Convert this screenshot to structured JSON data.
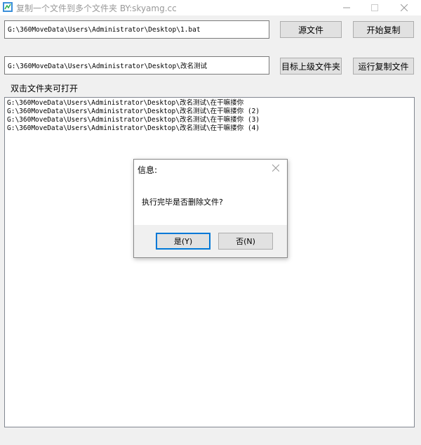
{
  "window": {
    "title": "复制一个文件到多个文件夹  BY:skyamg.cc"
  },
  "source": {
    "path": "G:\\360MoveData\\Users\\Administrator\\Desktop\\1.bat",
    "button_label": "源文件",
    "start_button_label": "开始复制"
  },
  "target": {
    "path": "G:\\360MoveData\\Users\\Administrator\\Desktop\\改名测试",
    "parent_button_label": "目标上级文件夹",
    "run_button_label": "运行复制文件"
  },
  "list": {
    "label": "双击文件夹可打开",
    "items": [
      "G:\\360MoveData\\Users\\Administrator\\Desktop\\改名测试\\在干嘛搂你",
      "G:\\360MoveData\\Users\\Administrator\\Desktop\\改名测试\\在干嘛搂你 (2)",
      "G:\\360MoveData\\Users\\Administrator\\Desktop\\改名测试\\在干嘛搂你 (3)",
      "G:\\360MoveData\\Users\\Administrator\\Desktop\\改名测试\\在干嘛搂你 (4)"
    ]
  },
  "dialog": {
    "title": "信息:",
    "message": "执行完毕是否删除文件?",
    "yes_label": "是(Y)",
    "no_label": "否(N)"
  },
  "icons": {
    "app": "app-icon",
    "minimize": "minimize-icon",
    "maximize": "maximize-icon",
    "close": "close-icon",
    "dialog_close": "close-icon"
  },
  "colors": {
    "accent": "#0078d7",
    "window_bg": "#f0f0f0",
    "title_text": "#999999"
  }
}
